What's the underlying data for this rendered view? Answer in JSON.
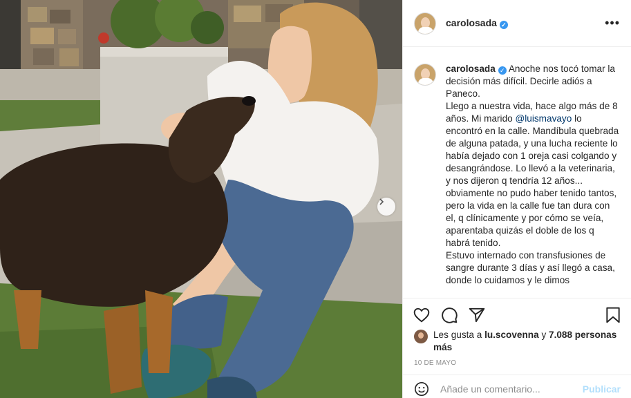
{
  "post": {
    "username": "carolosada",
    "verified_mark": "✓",
    "more_label": "•••",
    "caption": {
      "username": "carolosada",
      "paragraphs": [
        "Anoche nos tocó tomar la decisión más difícil. Decirle adiós a Paneco.",
        "Llego a nuestra vida, hace algo más de 8 años. Mi marido",
        "@luismavayo",
        "lo encontró en la calle. Mandíbula quebrada de alguna patada, y una lucha reciente lo había dejado con 1 oreja casi colgando y desangrándose. Lo llevó a la veterinaria, y nos dijeron q tendría 12 años... obviamente no pudo haber tenido tantos, pero la vida en la calle fue tan dura con el, q clínicamente y por cómo se veía, aparentaba quizás el doble de los q habrá tenido.",
        "Estuvo internado con transfusiones de sangre durante 3 días y así llegó a casa, donde lo cuidamos y le dimos"
      ]
    },
    "likes": {
      "prefix": "Les gusta a",
      "first_user": "lu.scovenna",
      "conj": "y",
      "others": "7.088 personas más"
    },
    "date": "10 de mayo",
    "comment": {
      "placeholder": "Añade un comentario...",
      "publish_label": "Publicar"
    },
    "icons": {
      "like": "heart-icon",
      "comment": "comment-bubble-icon",
      "share": "paper-plane-icon",
      "save": "bookmark-icon",
      "emoji": "smiley-icon",
      "next": "chevron-right-icon"
    },
    "colors": {
      "link": "#00376b",
      "publish_disabled": "#b2dffc",
      "verified": "#3897f0",
      "muted": "#8e8e8e"
    }
  }
}
